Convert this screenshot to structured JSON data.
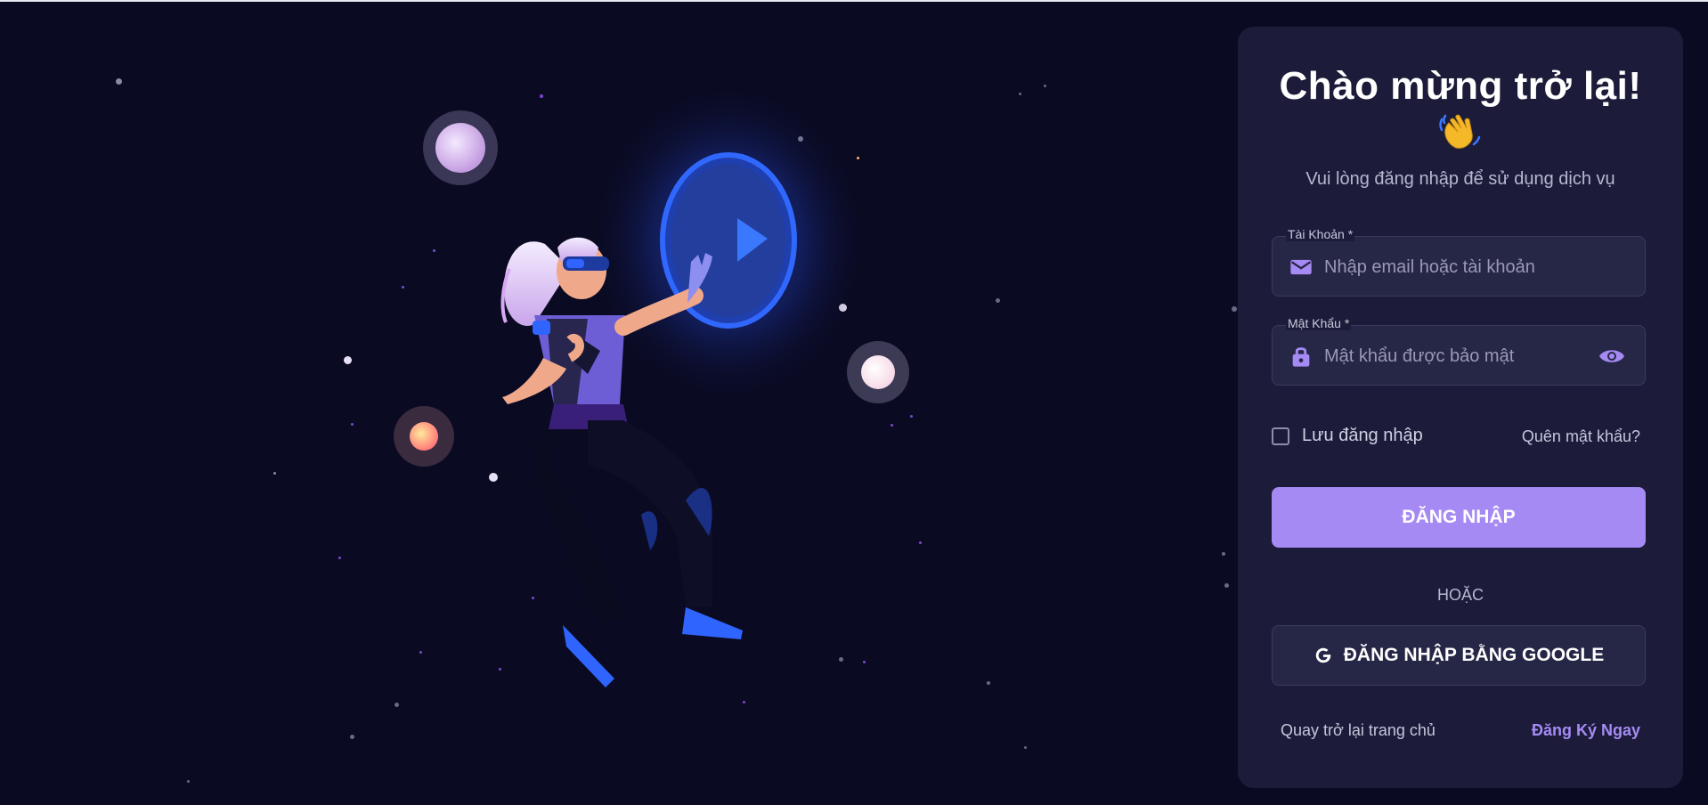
{
  "login": {
    "title": "Chào mừng trở lại!",
    "wave_icon": "waving-hand-emoji",
    "subtitle": "Vui lòng đăng nhập để sử dụng dịch vụ",
    "account_label": "Tài Khoản *",
    "account_placeholder": "Nhập email hoặc tài khoản",
    "password_label": "Mật Khẩu *",
    "password_placeholder": "Mật khẩu được bảo mật",
    "remember_label": "Lưu đăng nhập",
    "forgot_label": "Quên mật khẩu?",
    "login_button": "ĐĂNG NHẬP",
    "or_label": "HOẶC",
    "google_button": "ĐĂNG NHẬP BẰNG GOOGLE",
    "back_home": "Quay trở lại trang chủ",
    "register": "Đăng Ký Ngay"
  },
  "icons": {
    "account": "envelope-icon",
    "password": "lock-icon",
    "visibility": "eye-icon",
    "google": "google-g-icon"
  },
  "colors": {
    "background": "#0a0a22",
    "panel": "#1c1c3a",
    "accent": "#a68af4",
    "field": "#262646",
    "portal": "#2f64ff"
  }
}
